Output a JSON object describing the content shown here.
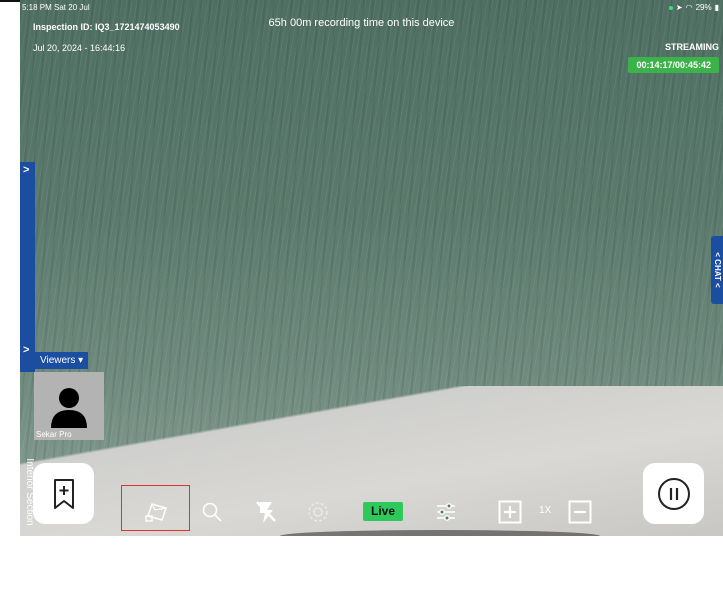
{
  "status_bar": {
    "time": "5:18 PM  Sat 20 Jul",
    "battery": "29%"
  },
  "inspection": {
    "id_text": "Inspection ID: IQ3_1721474053490",
    "datetime": "Jul 20, 2024 - 16:44:16"
  },
  "recording": {
    "remaining_text": "65h 00m recording time on this device"
  },
  "streaming": {
    "label": "STREAMING",
    "timer": "00:14:17/00:45:42"
  },
  "side_panel": {
    "label": "Interior Section"
  },
  "viewers": {
    "label": "Viewers ▾",
    "participant": "Sekar Pro"
  },
  "chat": {
    "label": "< CHAT <"
  },
  "toolbar": {
    "live_label": "Live",
    "zoom_label": "1X",
    "icons": [
      "bookmark-plus-icon",
      "camera-icon",
      "search-icon",
      "flash-off-icon",
      "focus-icon",
      "settings-sliders-icon",
      "zoom-in-icon",
      "zoom-out-icon",
      "pause-icon"
    ]
  },
  "colors": {
    "accent_blue": "#1b4ea1",
    "live_green": "#2ec95a",
    "timer_green": "#3bb34a",
    "highlight_red": "#e03030"
  }
}
